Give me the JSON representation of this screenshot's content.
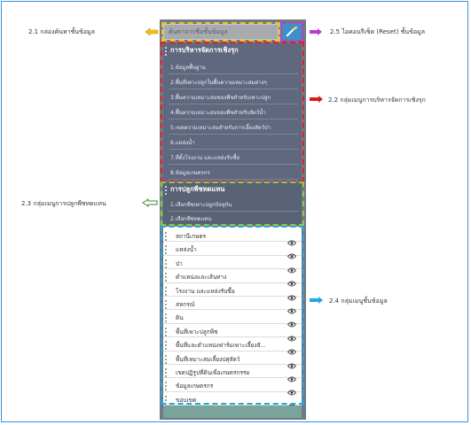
{
  "search": {
    "placeholder": "ค้นหาจากชื่อชั้นข้อมูล"
  },
  "groups": {
    "management": {
      "title": "การบริหารจัดการเชิงรุก",
      "items": [
        "1.ข้อมูลพื้นฐาน",
        "2.พื้นที่เพาะปลูกในพื้นความเหมาะสมต่างๆ",
        "3.พื้นความเหมาะสมของพืชสำหรับเพาะปลูก",
        "4.พื้นความเหมาะสมของพืชสำหรับสัตว์น้ำ",
        "5.เขตความเหมาะสมสำหรับการเลี้ยงสัตว์ป่า",
        "6.แหล่งน้ำ",
        "7.ที่ตั้งโรงงาน และแหล่งรับซื้อ",
        "8.ข้อมูลเกษตรกร"
      ]
    },
    "planting": {
      "title": "การปลูกพืชทดแทน",
      "items": [
        "1.เลือกพืชเพาะปลูกปัจจุบัน",
        "2.เลือกพืชทดแทน"
      ]
    }
  },
  "layers": [
    "สถานีเกษตร",
    "แหล่งน้ำ",
    "ป่า",
    "ตำแหน่งและเส้นทาง",
    "โรงงาน และแหล่งรับซื้อ",
    "สหกรณ์",
    "ดิน",
    "พื้นที่เพาะปลูกพืช",
    "พื้นที่และตำแหน่งฟาร์มเพาะเลี้ยงสั...",
    "พื้นที่เหมาะสมเลี้ยงปศุสัตว์",
    "เขตปฏิรูปที่ดินเพื่อเกษตรกรรม",
    "ข้อมูลเกษตรกร",
    "ขอบเขต"
  ],
  "annotations": {
    "a21": "2.1 กล่องค้นหาชั้นข้อมูล",
    "a25": "2.5 ไอคอนรีเซ็ต (Reset) ชั้นข้อมูล",
    "a22": "2.2 กลุ่มเมนูการบริหารจัดการเชิงรุก",
    "a23": "2.3 กลุ่มเมนูการปลูกพืชทดแทน",
    "a24": "2.4 กลุ่มเมนูชั้นข้อมูล"
  },
  "colors": {
    "search_box": "#f0c020",
    "reset_box": "#b23fd1",
    "mgmt_box": "#e02020",
    "plant_box": "#8ec84a",
    "layers_box": "#23a7e0"
  }
}
